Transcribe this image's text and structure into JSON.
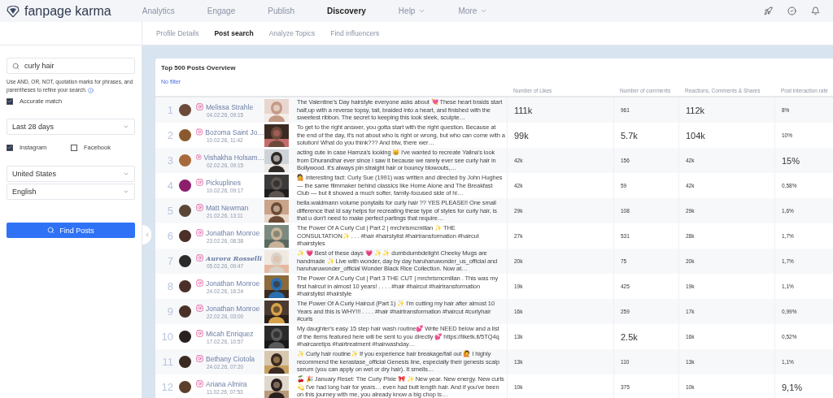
{
  "brand": "fanpage karma",
  "nav": [
    {
      "label": "Analytics",
      "selected": false,
      "dropdown": false
    },
    {
      "label": "Engage",
      "selected": false,
      "dropdown": false
    },
    {
      "label": "Publish",
      "selected": false,
      "dropdown": false
    },
    {
      "label": "Discovery",
      "selected": true,
      "dropdown": false
    },
    {
      "label": "Help",
      "selected": false,
      "dropdown": true
    },
    {
      "label": "More",
      "selected": false,
      "dropdown": true
    }
  ],
  "subnav": [
    {
      "label": "Profile Details",
      "selected": false
    },
    {
      "label": "Post search",
      "selected": true
    },
    {
      "label": "Analyze Topics",
      "selected": false
    },
    {
      "label": "Find influencers",
      "selected": false
    }
  ],
  "sidebar": {
    "search": {
      "value": "curly hair"
    },
    "hint": "Use AND, OR, NOT, quotation marks for phrases, and parentheses to refine your search.",
    "accurate_match": {
      "label": "Accurate match",
      "checked": true
    },
    "period": "Last 28 days",
    "networks": [
      {
        "label": "Instagram",
        "checked": true
      },
      {
        "label": "Facebook",
        "checked": false
      }
    ],
    "country": "United States",
    "language": "English",
    "button": "Find Posts"
  },
  "card": {
    "title": "Top 500 Posts Overview",
    "filter": "No filter",
    "columns": [
      "Number of Likes",
      "Number of comments",
      "Reactions, Comments & Shares",
      "Post interaction rate"
    ],
    "rows": [
      {
        "rank": "1",
        "author": "Melissa Strahle",
        "fancy": false,
        "date": "04.02.26, 09:15",
        "text": "The Valentine's Day hairstyle everyone asks about 💘 These heart braids start half,up with a reverse topsy, tail, braided into a heart, and finished with the sweetest ribbon. The secret to keeping this look sleek, sculpte…",
        "metrics": [
          {
            "text": "111k",
            "large": true
          },
          {
            "text": "961",
            "large": false
          },
          {
            "text": "112k",
            "large": true
          },
          {
            "text": "8%",
            "large": false
          }
        ]
      },
      {
        "rank": "2",
        "author": "Bozoma Saint Jo…",
        "fancy": false,
        "date": "10.02.26, 11:42",
        "text": "To get to the right answer, you gotta start with the right question. Because at the end of the day, it's not about who is right or wrong, but who can come with a solution! What do you think??? And btw, there wer…",
        "metrics": [
          {
            "text": "99k",
            "large": true
          },
          {
            "text": "5.7k",
            "large": true
          },
          {
            "text": "104k",
            "large": true
          },
          {
            "text": "10%",
            "large": false
          }
        ]
      },
      {
        "rank": "3",
        "author": "Vishakha Holsam…",
        "fancy": false,
        "date": "02.02.26, 09:15",
        "text": "acting cute in case Hamza's looking 😸 i've wanted to recreate Yalina's look from Dhurandhar ever since i saw it because we rarely ever see curly hair in Bollywood. it's always pin straight hair or bouncy blowouts,…",
        "metrics": [
          {
            "text": "42k",
            "large": false
          },
          {
            "text": "156",
            "large": false
          },
          {
            "text": "42k",
            "large": false
          },
          {
            "text": "15%",
            "large": true
          }
        ]
      },
      {
        "rank": "4",
        "author": "Pickuplines",
        "fancy": false,
        "date": "10.02.26, 09:17",
        "text": "💁 interesting fact: Curly Sue (1991) was written and directed by John Hughes — the same filmmaker behind classics like Home Alone and The Breakfast Club — but it showed a much softer, family-focused side of hi…",
        "metrics": [
          {
            "text": "42k",
            "large": false
          },
          {
            "text": "59",
            "large": false
          },
          {
            "text": "42k",
            "large": false
          },
          {
            "text": "0,58%",
            "large": false
          }
        ]
      },
      {
        "rank": "5",
        "author": "Matt Newman",
        "fancy": false,
        "date": "21.02.26, 13:11",
        "text": "bella.waldmann volume ponytails for curly hair ?? YES PLEASE!! One small difference that id say helps for recreating these type of styles for curly hair, is that u don't need to make perfect partings that require…",
        "metrics": [
          {
            "text": "29k",
            "large": false
          },
          {
            "text": "108",
            "large": false
          },
          {
            "text": "29k",
            "large": false
          },
          {
            "text": "1,6%",
            "large": false
          }
        ]
      },
      {
        "rank": "6",
        "author": "Jonathan Monroe",
        "fancy": false,
        "date": "23.02.26, 08:38",
        "text": "The Power Of A Curly Cut | Part 2 | mrchrismcmillan ✨ THE CONSULTATION✨ . . . #hair #hairstylist #hairtransformation #haircut #hairstyles",
        "metrics": [
          {
            "text": "27k",
            "large": false
          },
          {
            "text": "531",
            "large": false
          },
          {
            "text": "28k",
            "large": false
          },
          {
            "text": "1,7%",
            "large": false
          }
        ]
      },
      {
        "rank": "7",
        "author": "Aurora Rosselli",
        "fancy": true,
        "date": "05.02.26, 09:47",
        "text": "✨ 💗 Best of these days 💗 ✨ ✨ dumbdumbdelight Cheeky Mugs are handmade ✨ Live with wonder, day by day haruharuwonder_us_official and haruharuwonder_official Wonder Black Rice Collection. Now at…",
        "metrics": [
          {
            "text": "20k",
            "large": false
          },
          {
            "text": "75",
            "large": false
          },
          {
            "text": "20k",
            "large": false
          },
          {
            "text": "1,7%",
            "large": false
          }
        ]
      },
      {
        "rank": "8",
        "author": "Jonathan Monroe",
        "fancy": false,
        "date": "24.02.26, 16:24",
        "text": "The Power Of A Curly Cut | Part 3 THE CUT | mrchrismcmillan . This was my first haircut in almost 10 years! . . . . #hair #haircut #hairtransformation #hairstylist #hairstyle",
        "metrics": [
          {
            "text": "19k",
            "large": false
          },
          {
            "text": "425",
            "large": false
          },
          {
            "text": "19k",
            "large": false
          },
          {
            "text": "1,1%",
            "large": false
          }
        ]
      },
      {
        "rank": "9",
        "author": "Jonathan Monroe",
        "fancy": false,
        "date": "22.02.26, 03:00",
        "text": "The Power Of A Curly Haircut (Part 1) ✨ I'm cutting my hair after almost 10 Years and this is WHY!!! . . . . #hair #hairtransformation #haircut #curlyhair #curls",
        "metrics": [
          {
            "text": "16k",
            "large": false
          },
          {
            "text": "259",
            "large": false
          },
          {
            "text": "17k",
            "large": false
          },
          {
            "text": "0,99%",
            "large": false
          }
        ]
      },
      {
        "rank": "10",
        "author": "Micah Enriquez",
        "fancy": false,
        "date": "17.02.26, 10:57",
        "text": "My daughter's easy 15 step hair wash routine💕 Write NEED below and a list of the items featured here will be sent to you directly 💕 https://liketk.it/5TQ4q #haircaretips #hairtreatment #hairwashday…",
        "metrics": [
          {
            "text": "13k",
            "large": false
          },
          {
            "text": "2.5k",
            "large": true
          },
          {
            "text": "16k",
            "large": false
          },
          {
            "text": "0,52%",
            "large": false
          }
        ]
      },
      {
        "rank": "11",
        "author": "Bethany Ciotola",
        "fancy": false,
        "date": "24.02.26, 07:20",
        "text": "✨ Curly hair routine✨ If you experience hair breakage/fall out 🙋 I highly recommend the kerastase_official Genesis line, especially their genesis scalp serum (you can apply on wet or dry hair). It smells…",
        "metrics": [
          {
            "text": "13k",
            "large": false
          },
          {
            "text": "110",
            "large": false
          },
          {
            "text": "13k",
            "large": false
          },
          {
            "text": "1,1%",
            "large": false
          }
        ]
      },
      {
        "rank": "12",
        "author": "Ariana Almira",
        "fancy": false,
        "date": "11.02.26, 07:53",
        "text": "🍒 🎉 January Reset: The Curly Pixie 🎀 ✨ New year. New energy. New curls 💫 I've had long hair for years… even had butt length hair. And if you've been on this journey with me, you already know a big chop is…",
        "metrics": [
          {
            "text": "10k",
            "large": false
          },
          {
            "text": "375",
            "large": false
          },
          {
            "text": "10k",
            "large": false
          },
          {
            "text": "9,1%",
            "large": true
          }
        ]
      }
    ]
  }
}
